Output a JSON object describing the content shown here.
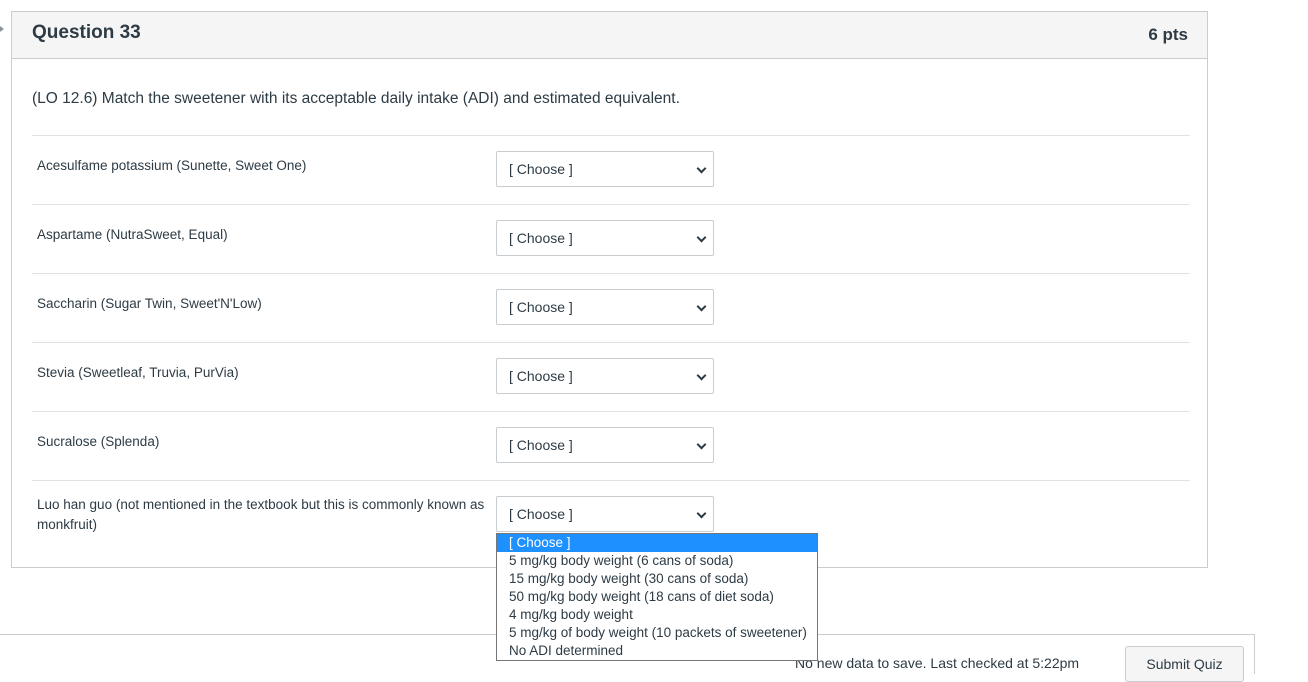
{
  "question": {
    "title": "Question 33",
    "points": "6 pts",
    "text": "(LO 12.6) Match the sweetener with its acceptable daily intake (ADI) and estimated equivalent."
  },
  "rows": [
    {
      "label": "Acesulfame potassium (Sunette, Sweet One)",
      "selected": "[ Choose ]"
    },
    {
      "label": "Aspartame (NutraSweet, Equal)",
      "selected": "[ Choose ]"
    },
    {
      "label": "Saccharin (Sugar Twin, Sweet'N'Low)",
      "selected": "[ Choose ]"
    },
    {
      "label": "Stevia (Sweetleaf, Truvia, PurVia)",
      "selected": "[ Choose ]"
    },
    {
      "label": "Sucralose (Splenda)",
      "selected": "[ Choose ]"
    },
    {
      "label": "Luo han guo (not mentioned in the textbook but this is commonly known as monkfruit)",
      "selected": "[ Choose ]"
    }
  ],
  "dropdown": {
    "options": [
      "[ Choose ]",
      "5 mg/kg body weight (6 cans of soda)",
      "15 mg/kg body weight (30 cans of soda)",
      "50 mg/kg body weight (18 cans of diet soda)",
      "4 mg/kg body weight",
      "5 mg/kg of body weight (10 packets of sweetener)",
      "No ADI determined"
    ],
    "highlighted": "[ Choose ]"
  },
  "footer": {
    "status": "No new data to save. Last checked at 5:22pm",
    "submit_label": "Submit Quiz"
  },
  "colors": {
    "highlight": "#1e90ff",
    "text": "#2d3b45",
    "border": "#c7cdd1",
    "header_bg": "#f5f5f5"
  }
}
